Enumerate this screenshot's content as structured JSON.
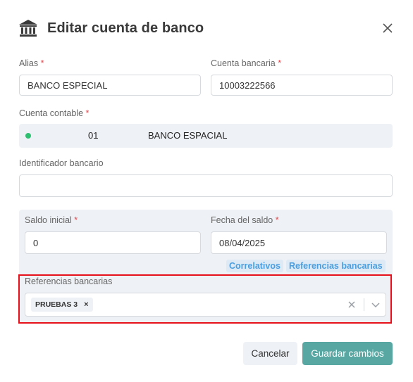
{
  "modal": {
    "title": "Editar cuenta de banco"
  },
  "fields": {
    "alias": {
      "label": "Alias",
      "required": "*",
      "value": "BANCO ESPECIAL"
    },
    "cuenta_bancaria": {
      "label": "Cuenta bancaria",
      "required": "*",
      "value": "10003222566"
    },
    "cuenta_contable": {
      "label": "Cuenta contable",
      "required": "*",
      "code": "01",
      "name": "BANCO ESPACIAL",
      "status_color": "#2fbf71"
    },
    "identificador": {
      "label": "Identificador bancario",
      "value": ""
    },
    "saldo_inicial": {
      "label": "Saldo inicial",
      "required": "*",
      "value": "0"
    },
    "fecha_saldo": {
      "label": "Fecha del saldo",
      "required": "*",
      "value": "08/04/2025"
    },
    "referencias": {
      "label": "Referencias bancarias",
      "tags": [
        {
          "label": "PRUEBAS 3",
          "remove": "×"
        }
      ]
    }
  },
  "links": {
    "correlativos": "Correlativos",
    "referencias": "Referencias bancarias"
  },
  "buttons": {
    "cancel": "Cancelar",
    "save": "Guardar cambios"
  },
  "colors": {
    "accent": "#58a7a2",
    "link": "#4a9fe0",
    "required": "#e5484d",
    "highlight": "#e5101a"
  }
}
